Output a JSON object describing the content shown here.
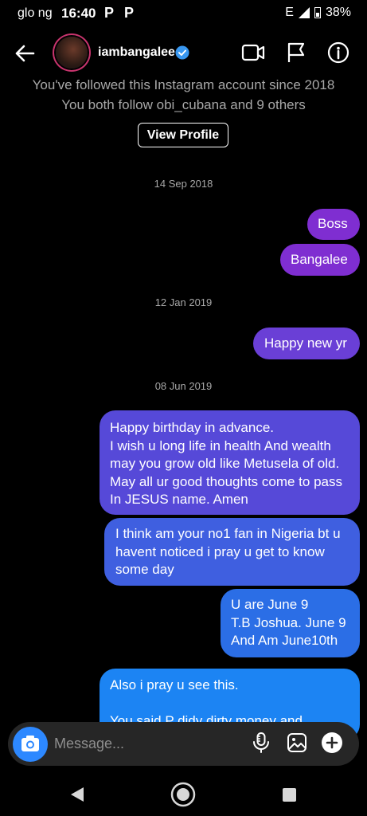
{
  "status_bar": {
    "carrier": "glo ng",
    "time": "16:40",
    "network": "E",
    "battery": "38%"
  },
  "header": {
    "username": "iambangalee"
  },
  "profile_info": {
    "line1": "You've followed this Instagram account since 2018",
    "line2": "You both follow obi_cubana and 9 others",
    "view_profile_label": "View Profile"
  },
  "messages": {
    "date1": "14 Sep 2018",
    "m1": "Boss",
    "m2": "Bangalee",
    "date2": "12 Jan 2019",
    "m3": "Happy new yr",
    "date3": "08 Jun 2019",
    "m4": "Happy birthday in advance.\nI wish u long life in health And wealth may you grow old like Metusela of old. May all ur good thoughts come to pass In JESUS name. Amen",
    "m5": "I think am your no1 fan in Nigeria bt u havent noticed i pray u get to know some day",
    "m6": "U are June 9\nT.B Joshua. June 9\nAnd Am June10th",
    "m7": "Also i pray u see this.\n\nYou said P didy dirty money and"
  },
  "composer": {
    "placeholder": "Message..."
  },
  "colors": {
    "bubble_purple": "#7f2ed1",
    "bubble_indigo": "#5649d8",
    "bubble_blue": "#2b6ee6",
    "bubble_lightblue": "#1c84f3",
    "accent": "#2d88ff"
  },
  "icons": [
    "back-arrow-icon",
    "verified-badge-icon",
    "video-call-icon",
    "flag-icon",
    "info-icon",
    "camera-icon",
    "microphone-icon",
    "gallery-icon",
    "add-icon",
    "nav-back-icon",
    "nav-home-icon",
    "nav-recents-icon"
  ]
}
